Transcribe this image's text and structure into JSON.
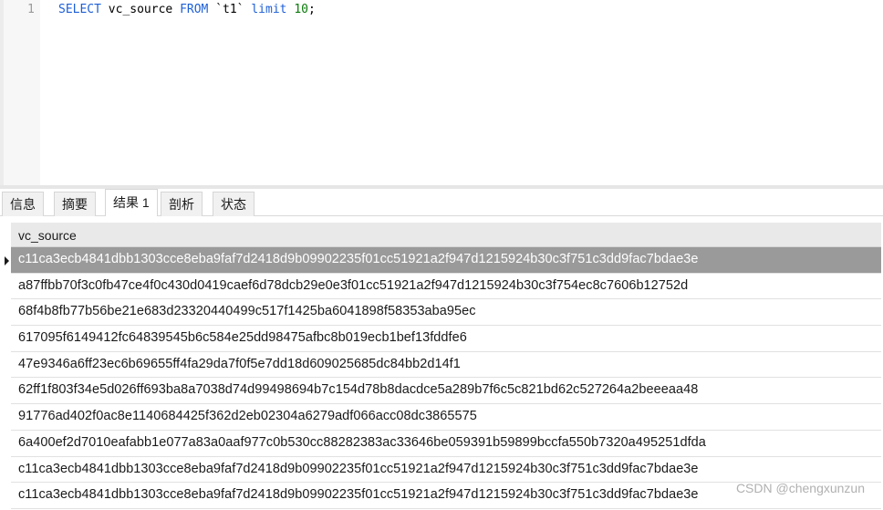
{
  "editor": {
    "line_number": "1",
    "sql": {
      "select": "SELECT",
      "column": " vc_source ",
      "from": "FROM",
      "table": " `t1` ",
      "limit": "limit",
      "space": " ",
      "count": "10",
      "semicolon": ";"
    }
  },
  "tabs": [
    {
      "label": "信息",
      "active": false
    },
    {
      "label": "摘要",
      "active": false
    },
    {
      "label": "结果 1",
      "active": true
    },
    {
      "label": "剖析",
      "active": false
    },
    {
      "label": "状态",
      "active": false
    }
  ],
  "grid": {
    "column_header": "vc_source",
    "selected_row_index": 0,
    "rows": [
      "c11ca3ecb4841dbb1303cce8eba9faf7d2418d9b09902235f01cc51921a2f947d1215924b30c3f751c3dd9fac7bdae3e",
      "a87ffbb70f3c0fb47ce4f0c430d0419caef6d78dcb29e0e3f01cc51921a2f947d1215924b30c3f754ec8c7606b12752d",
      "68f4b8fb77b56be21e683d23320440499c517f1425ba6041898f58353aba95ec",
      "617095f6149412fc64839545b6c584e25dd98475afbc8b019ecb1bef13fddfe6",
      "47e9346a6ff23ec6b69655ff4fa29da7f0f5e7dd18d609025685dc84bb2d14f1",
      "62ff1f803f34e5d026ff693ba8a7038d74d99498694b7c154d78b8dacdce5a289b7f6c5c821bd62c527264a2beeeaa48",
      "91776ad402f0ac8e1140684425f362d2eb02304a6279adf066acc08dc3865575",
      "6a400ef2d7010eafabb1e077a83a0aaf977c0b530cc88282383ac33646be059391b59899bccfa550b7320a495251dfda",
      "c11ca3ecb4841dbb1303cce8eba9faf7d2418d9b09902235f01cc51921a2f947d1215924b30c3f751c3dd9fac7bdae3e",
      "c11ca3ecb4841dbb1303cce8eba9faf7d2418d9b09902235f01cc51921a2f947d1215924b30c3f751c3dd9fac7bdae3e"
    ]
  },
  "watermark": "CSDN @chengxunzun"
}
